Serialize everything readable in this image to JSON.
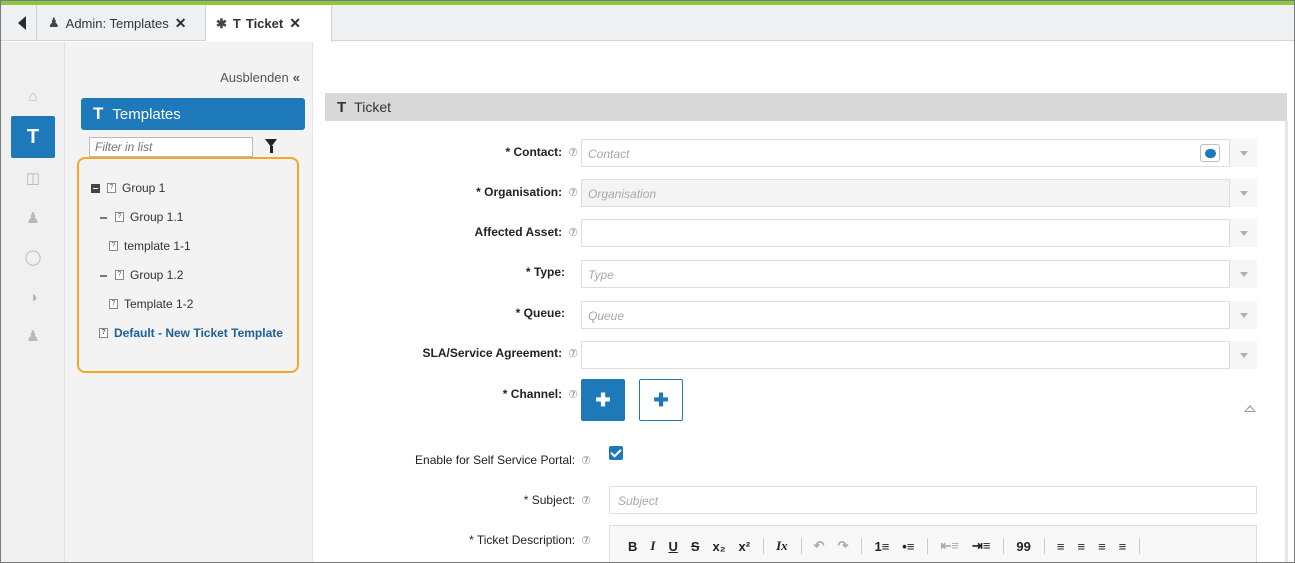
{
  "tabs": [
    {
      "label": "Admin: Templates",
      "icon": "users-icon",
      "close": "✕"
    },
    {
      "label": "Ticket",
      "icon": "pin-icon",
      "prefix": "T",
      "close": "✕"
    }
  ],
  "rail": {
    "items": [
      "home-icon",
      "tickets-icon",
      "database-icon",
      "contacts-icon",
      "lightbulb-icon",
      "reports-icon",
      "admin-icon"
    ],
    "active_label": "T"
  },
  "panel": {
    "hide_label": "Ausblenden",
    "hide_chevron": "«",
    "header_icon": "T",
    "header_title": "Templates",
    "filter_placeholder": "Filter in list",
    "tree": [
      {
        "label": "Group 1"
      },
      {
        "label": "Group 1.1"
      },
      {
        "label": "template 1-1"
      },
      {
        "label": "Group 1.2"
      },
      {
        "label": "Template 1-2"
      },
      {
        "label": "Default - New Ticket Template"
      }
    ]
  },
  "main": {
    "header_icon": "T",
    "header_title": "Ticket",
    "fields": {
      "contact": {
        "label": "* Contact:",
        "placeholder": "Contact"
      },
      "organisation": {
        "label": "* Organisation:",
        "placeholder": "Organisation"
      },
      "affected_asset": {
        "label": "Affected Asset:",
        "placeholder": ""
      },
      "type": {
        "label": "* Type:",
        "placeholder": "Type"
      },
      "queue": {
        "label": "* Queue:",
        "placeholder": "Queue"
      },
      "sla": {
        "label": "SLA/Service Agreement:",
        "placeholder": ""
      },
      "channel": {
        "label": "* Channel:"
      },
      "self_service": {
        "label": "Enable for Self Service Portal:",
        "checked": true
      },
      "subject": {
        "label": "* Subject:",
        "placeholder": "Subject"
      },
      "description": {
        "label": "* Ticket Description:"
      }
    },
    "help_glyph": "⑦",
    "editor_toolbar": [
      "B",
      "I",
      "U",
      "S",
      "x₂",
      "x²",
      "Ix",
      "↶",
      "↷",
      "1≡",
      "•≡",
      "⇤≡",
      "⇥≡",
      "99",
      "≡",
      "≡",
      "≡",
      "≡"
    ]
  },
  "colors": {
    "accent": "#1d79b9",
    "highlight_border": "#f5a623",
    "top_line": "#8dc63f"
  }
}
